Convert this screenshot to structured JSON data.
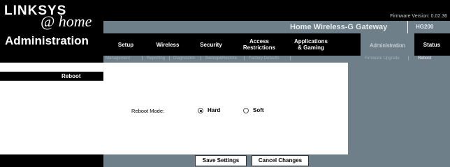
{
  "brand": {
    "logo": "LINKSYS",
    "tagline": "@ home"
  },
  "header": {
    "firmware": "Firmware Version: 0.02.36",
    "product_name": "Home Wireless-G Gateway",
    "model": "HG200"
  },
  "section": {
    "title": "Administration"
  },
  "nav": {
    "items": [
      {
        "label": "Setup"
      },
      {
        "label": "Wireless"
      },
      {
        "label": "Security"
      },
      {
        "label": "Access\nRestrictions"
      },
      {
        "label": "Applications\n& Gaming"
      },
      {
        "label": "Administration"
      },
      {
        "label": "Status"
      }
    ],
    "active": "Administration"
  },
  "subnav": {
    "items": [
      {
        "label": "Management"
      },
      {
        "label": "Reporting"
      },
      {
        "label": "Diagnostics"
      },
      {
        "label": "Backup&Restore"
      },
      {
        "label": "Factory Defaults"
      },
      {
        "label": "Firmware Upgrade"
      },
      {
        "label": "Reboot"
      }
    ],
    "active": "Reboot"
  },
  "content": {
    "heading": "Reboot",
    "mode_label": "Reboot Mode:",
    "options": [
      {
        "label": "Hard",
        "selected": true
      },
      {
        "label": "Soft",
        "selected": false
      }
    ]
  },
  "buttons": {
    "save": "Save Settings",
    "cancel": "Cancel Changes"
  },
  "colors": {
    "header_bg": "#000000",
    "band": "#6f7f8a",
    "content_bg": "#ffffff"
  }
}
